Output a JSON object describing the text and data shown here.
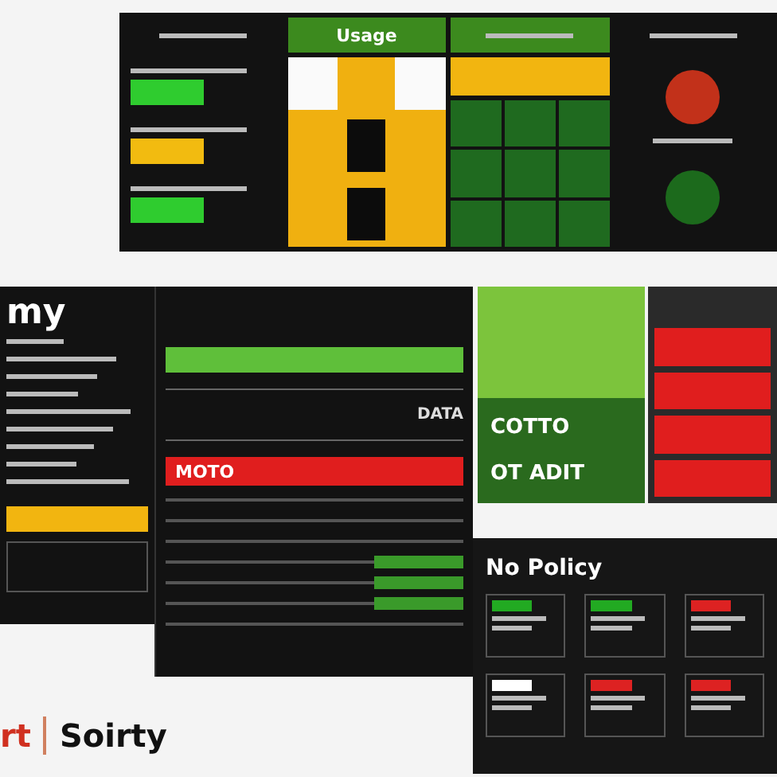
{
  "top_panel": {
    "columns": [
      {
        "kind": "dark"
      },
      {
        "kind": "grid_yellow",
        "title": "Usage"
      },
      {
        "kind": "grid_green"
      },
      {
        "kind": "circles"
      }
    ]
  },
  "left_panel": {
    "title": "my"
  },
  "center_panel": {
    "label": "DATA",
    "alert": "MOTO"
  },
  "green_panel": {
    "items": [
      "COTTO",
      "OT ADIT"
    ]
  },
  "policy_panel": {
    "title": "No Policy",
    "cards": [
      {
        "color": "#22aa22"
      },
      {
        "color": "#22aa22"
      },
      {
        "color": "#dd2222"
      },
      {
        "color": "#ffffff"
      },
      {
        "color": "#dd2222"
      },
      {
        "color": "#dd2222"
      }
    ]
  },
  "logo": {
    "left": "rt",
    "right": "Soirty"
  }
}
